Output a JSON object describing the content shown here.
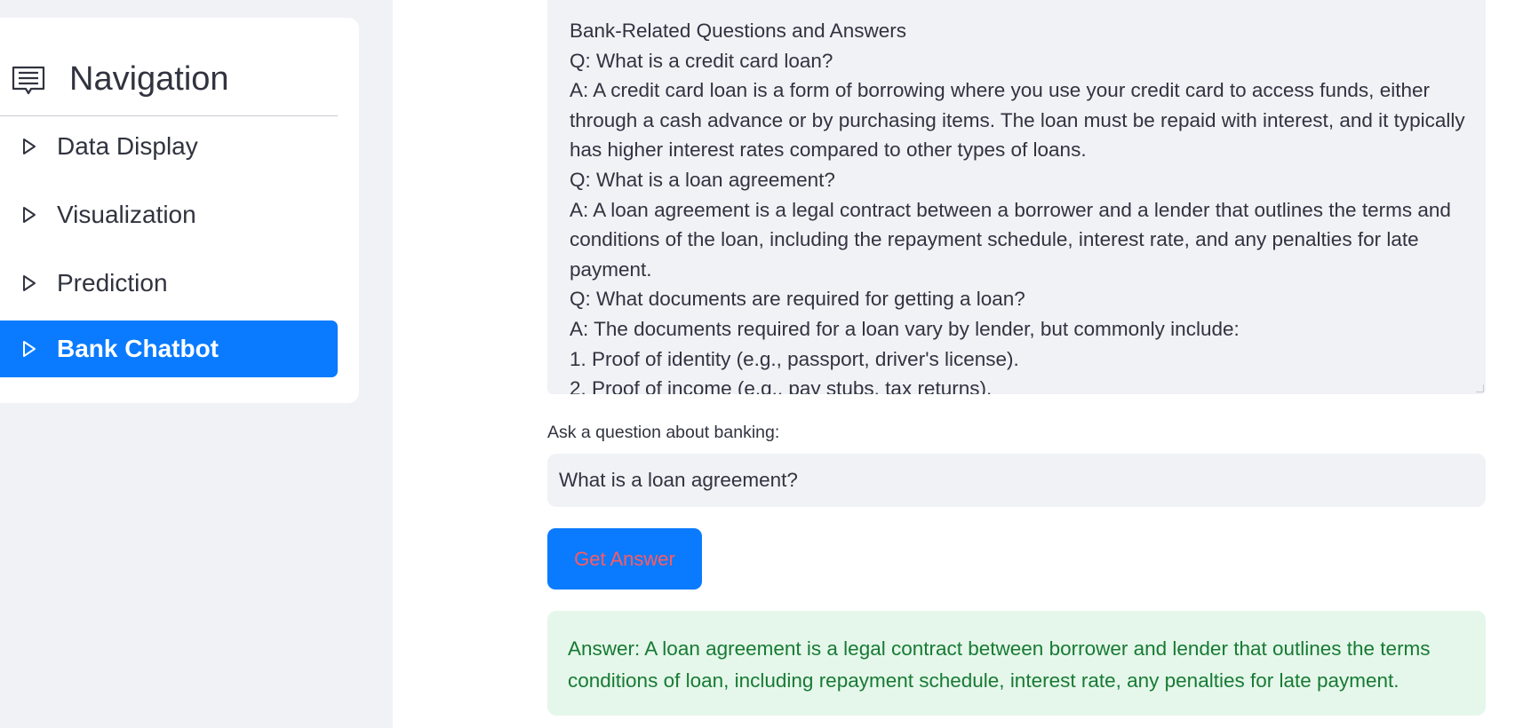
{
  "sidebar": {
    "title": "Navigation",
    "items": [
      {
        "label": "Data Display",
        "active": false
      },
      {
        "label": "Visualization",
        "active": false
      },
      {
        "label": "Prediction",
        "active": false
      },
      {
        "label": "Bank Chatbot",
        "active": true
      }
    ]
  },
  "main": {
    "qa_text": "Bank-Related Questions and Answers\nQ: What is a credit card loan?\nA: A credit card loan is a form of borrowing where you use your credit card to access funds, either through a cash advance or by purchasing items. The loan must be repaid with interest, and it typically has higher interest rates compared to other types of loans.\nQ: What is a loan agreement?\nA: A loan agreement is a legal contract between a borrower and a lender that outlines the terms and conditions of the loan, including the repayment schedule, interest rate, and any penalties for late payment.\nQ: What documents are required for getting a loan?\nA: The documents required for a loan vary by lender, but commonly include:\n1. Proof of identity (e.g., passport, driver's license).\n2. Proof of income (e.g., pay stubs, tax returns).",
    "ask_label": "Ask a question about banking:",
    "question_value": "What is a loan agreement?",
    "button_label": "Get Answer",
    "answer": "Answer: A loan agreement is a legal contract between borrower and lender that outlines the terms conditions of loan, including repayment schedule, interest rate, any penalties for late payment."
  },
  "colors": {
    "accent": "#0a7bff",
    "sidebar_bg": "#f0f2f6",
    "answer_bg": "#e5f7ea",
    "answer_text": "#177a34",
    "button_text": "#ff5a5f"
  },
  "icons": {
    "nav_header": "menu-list-icon",
    "nav_item": "triangle-right-icon"
  }
}
